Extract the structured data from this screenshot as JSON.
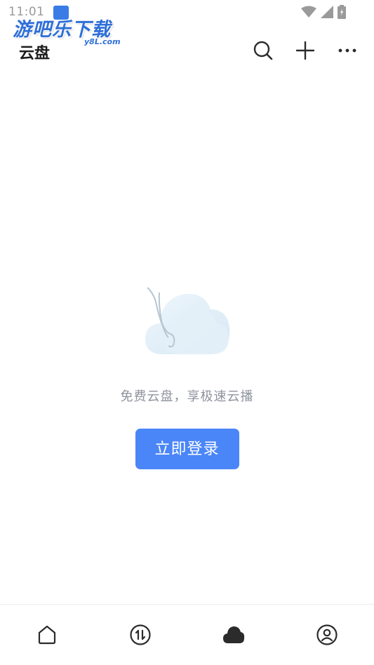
{
  "status_bar": {
    "time": "11:01",
    "icons": [
      "notification-icon",
      "wifi-icon",
      "signal-icon",
      "battery-icon"
    ]
  },
  "watermark": {
    "main_text": "游吧乐下载",
    "sub_text": "y8L.com"
  },
  "header": {
    "title": "云盘",
    "actions": [
      "search-icon",
      "plus-icon",
      "more-icon"
    ]
  },
  "empty_state": {
    "message": "免费云盘，享极速云播",
    "login_label": "立即登录"
  },
  "bottom_nav": {
    "items": [
      {
        "icon": "home-icon",
        "active": false
      },
      {
        "icon": "transfer-icon",
        "active": false
      },
      {
        "icon": "cloud-icon",
        "active": true
      },
      {
        "icon": "profile-icon",
        "active": false
      }
    ]
  },
  "colors": {
    "accent": "#4a86f7",
    "muted_text": "#8e939c",
    "title_text": "#1d1d1d",
    "icon": "#2b2b2b"
  }
}
